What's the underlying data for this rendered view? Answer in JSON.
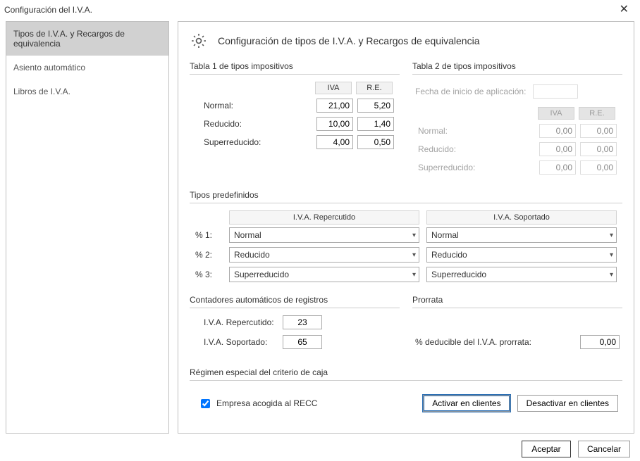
{
  "window": {
    "title": "Configuración del I.V.A."
  },
  "sidebar": {
    "items": [
      {
        "id": "tipos",
        "label": "Tipos de I.V.A. y Recargos de equivalencia",
        "active": true
      },
      {
        "id": "asiento",
        "label": "Asiento automático",
        "active": false
      },
      {
        "id": "libros",
        "label": "Libros de I.V.A.",
        "active": false
      }
    ]
  },
  "header": {
    "title": "Configuración de tipos de I.V.A. y Recargos de equivalencia"
  },
  "table1": {
    "heading": "Tabla 1 de tipos impositivos",
    "cols": {
      "iva": "IVA",
      "re": "R.E."
    },
    "rows": {
      "normal": {
        "label": "Normal:",
        "iva": "21,00",
        "re": "5,20"
      },
      "reducido": {
        "label": "Reducido:",
        "iva": "10,00",
        "re": "1,40"
      },
      "superreducido": {
        "label": "Superreducido:",
        "iva": "4,00",
        "re": "0,50"
      }
    }
  },
  "table2": {
    "heading": "Tabla 2 de tipos impositivos",
    "start_date_label": "Fecha de inicio de aplicación:",
    "start_date_value": "",
    "cols": {
      "iva": "IVA",
      "re": "R.E."
    },
    "rows": {
      "normal": {
        "label": "Normal:",
        "iva": "0,00",
        "re": "0,00"
      },
      "reducido": {
        "label": "Reducido:",
        "iva": "0,00",
        "re": "0,00"
      },
      "superreducido": {
        "label": "Superreducido:",
        "iva": "0,00",
        "re": "0,00"
      }
    }
  },
  "predef": {
    "heading": "Tipos predefinidos",
    "col_repercutido": "I.V.A. Repercutido",
    "col_soportado": "I.V.A. Soportado",
    "rows": {
      "r1": {
        "label": "% 1:",
        "repercutido": "Normal",
        "soportado": "Normal"
      },
      "r2": {
        "label": "% 2:",
        "repercutido": "Reducido",
        "soportado": "Reducido"
      },
      "r3": {
        "label": "% 3:",
        "repercutido": "Superreducido",
        "soportado": "Superreducido"
      }
    }
  },
  "counters": {
    "heading": "Contadores automáticos de registros",
    "repercutido": {
      "label": "I.V.A. Repercutido:",
      "value": "23"
    },
    "soportado": {
      "label": "I.V.A. Soportado:",
      "value": "65"
    }
  },
  "prorrata": {
    "heading": "Prorrata",
    "label": "% deducible del I.V.A. prorrata:",
    "value": "0,00"
  },
  "recc": {
    "heading": "Régimen especial del criterio de caja",
    "checkbox_label": "Empresa acogida al RECC",
    "checked": true,
    "btn_activar": "Activar en clientes",
    "btn_desactivar": "Desactivar en clientes"
  },
  "footer": {
    "ok": "Aceptar",
    "cancel": "Cancelar"
  }
}
